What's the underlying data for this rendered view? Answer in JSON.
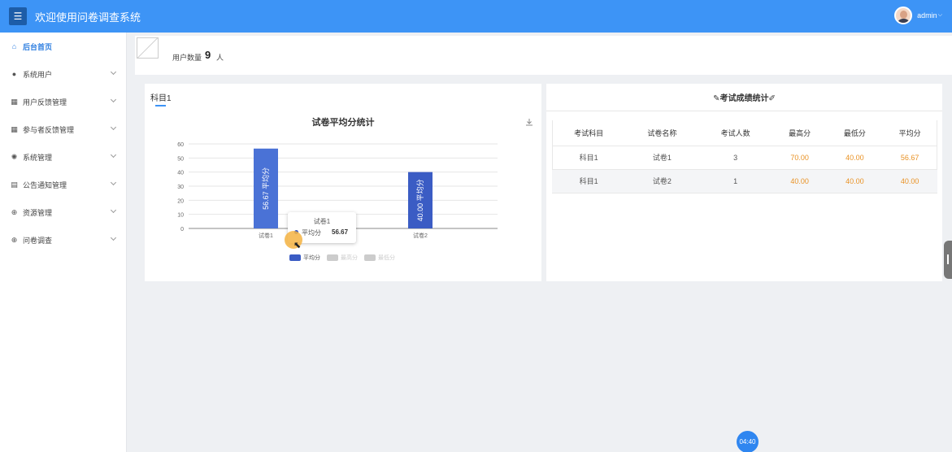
{
  "header": {
    "menu_icon": "hamburger-icon",
    "title": "欢迎使用问卷调查系统",
    "username": "admin",
    "accent": "#3d94f6"
  },
  "sidebar": {
    "items": [
      {
        "label": "后台首页",
        "icon": "home-icon",
        "active": true
      },
      {
        "label": "系统用户",
        "icon": "user-icon"
      },
      {
        "label": "用户反馈管理",
        "icon": "grid-icon"
      },
      {
        "label": "参与者反馈管理",
        "icon": "grid-icon"
      },
      {
        "label": "系统管理",
        "icon": "gear-icon"
      },
      {
        "label": "公告通知管理",
        "icon": "document-icon"
      },
      {
        "label": "资源管理",
        "icon": "plus-circle-icon"
      },
      {
        "label": "问卷调查",
        "icon": "plus-circle-icon"
      }
    ]
  },
  "stats": {
    "label": "用户数量",
    "value": "9",
    "unit": "人"
  },
  "left_panel": {
    "tab": "科目1",
    "chart_title": "试卷平均分统计",
    "tooltip": {
      "title": "试卷1",
      "series": "平均分",
      "value": "56.67"
    }
  },
  "chart_data": {
    "type": "bar",
    "title": "试卷平均分统计",
    "categories": [
      "试卷1",
      "试卷2"
    ],
    "series": [
      {
        "name": "平均分",
        "values": [
          56.67,
          40.0
        ],
        "color": "#3b5cc4"
      },
      {
        "name": "最高分",
        "values": [],
        "color": "#cccccc"
      },
      {
        "name": "最低分",
        "values": [],
        "color": "#cccccc"
      }
    ],
    "bar_labels": [
      "56.67 平均分",
      "40.00 平均分"
    ],
    "ylim": [
      0,
      60
    ],
    "yticks": [
      "0",
      "10",
      "20",
      "30",
      "40",
      "50",
      "60"
    ],
    "grid": true,
    "legend": "bottom"
  },
  "right_panel": {
    "title": "✎考试成绩统计✐",
    "columns": [
      "考试科目",
      "试卷名称",
      "考试人数",
      "最高分",
      "最低分",
      "平均分"
    ],
    "rows": [
      [
        "科目1",
        "试卷1",
        "3",
        "70.00",
        "40.00",
        "56.67"
      ],
      [
        "科目1",
        "试卷2",
        "1",
        "40.00",
        "40.00",
        "40.00"
      ]
    ],
    "score_color": "#e99225"
  },
  "timer": "04:40"
}
